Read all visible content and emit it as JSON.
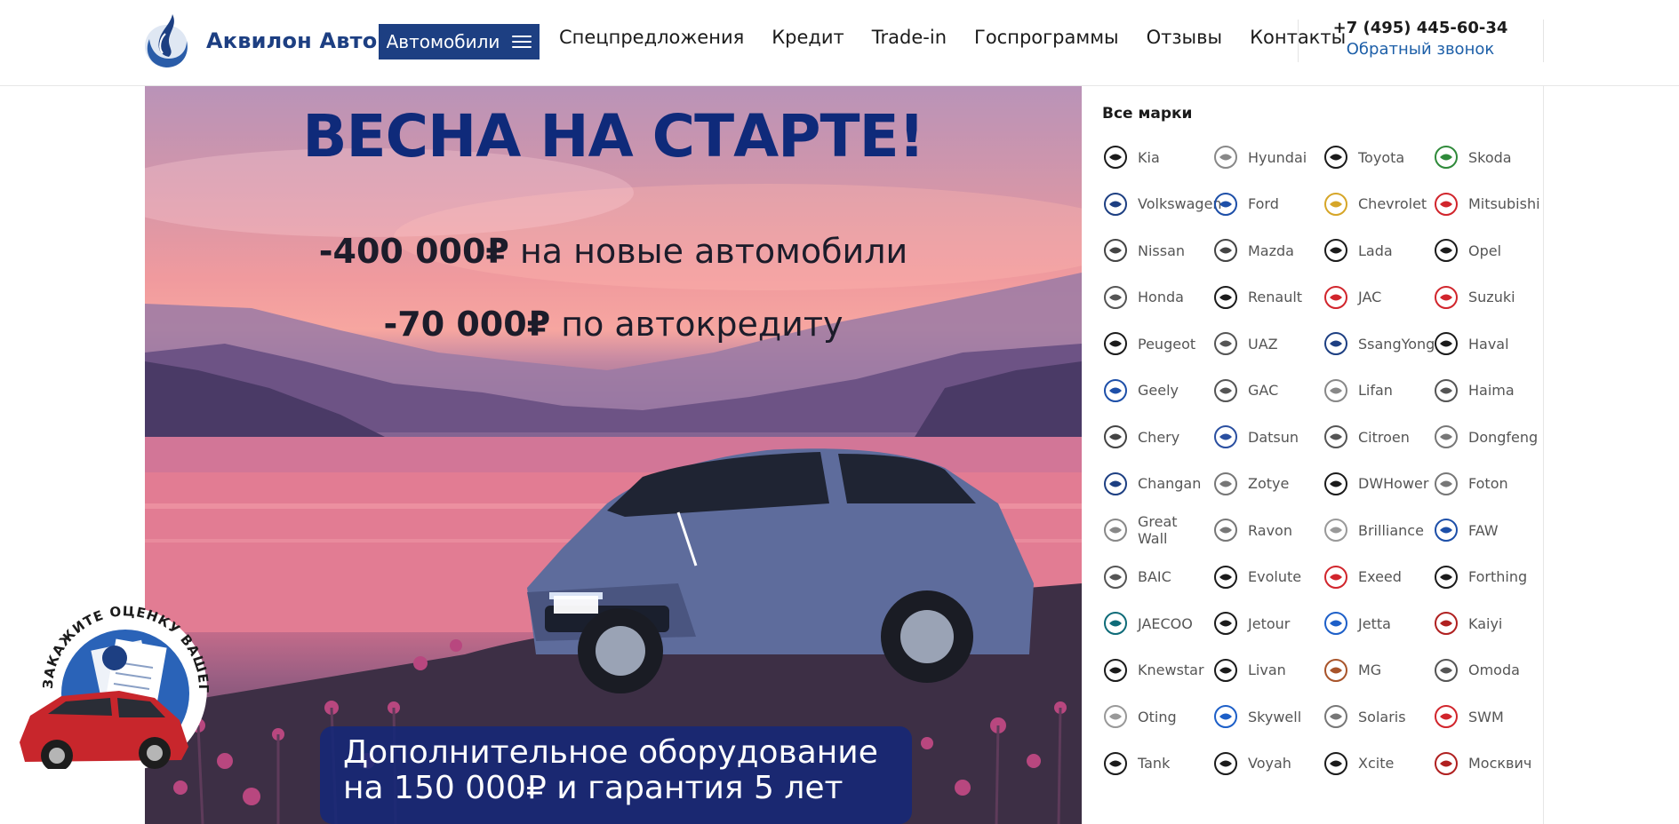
{
  "header": {
    "logo_text": "Аквилон Авто",
    "cars_button": "Автомобили",
    "nav": [
      "Спецпредложения",
      "Кредит",
      "Trade-in",
      "Госпрограммы",
      "Отзывы",
      "Контакты"
    ],
    "phone": "+7 (495) 445-60-34",
    "callback": "Обратный звонок"
  },
  "hero": {
    "title": "ВЕСНА НА СТАРТЕ!",
    "offer1_amount": "-400 000₽",
    "offer1_text": " на новые автомобили",
    "offer2_amount": "-70 000₽",
    "offer2_text": " по автокредиту",
    "banner_line1": "Дополнительное оборудование",
    "banner_line2": "на 150 000₽ и гарантия 5 лет",
    "sticker_text": "ЗАКАЖИТЕ ОЦЕНКУ ВАШЕГО АВТОМОБИЛЯ"
  },
  "brands": {
    "title": "Все марки",
    "items": [
      {
        "name": "Kia",
        "icon": "kia-logo"
      },
      {
        "name": "Hyundai",
        "icon": "hyundai-logo"
      },
      {
        "name": "Toyota",
        "icon": "toyota-logo"
      },
      {
        "name": "Skoda",
        "icon": "skoda-logo"
      },
      {
        "name": "Volkswagen",
        "icon": "volkswagen-logo"
      },
      {
        "name": "Ford",
        "icon": "ford-logo"
      },
      {
        "name": "Chevrolet",
        "icon": "chevrolet-logo"
      },
      {
        "name": "Mitsubishi",
        "icon": "mitsubishi-logo"
      },
      {
        "name": "Nissan",
        "icon": "nissan-logo"
      },
      {
        "name": "Mazda",
        "icon": "mazda-logo"
      },
      {
        "name": "Lada",
        "icon": "lada-logo"
      },
      {
        "name": "Opel",
        "icon": "opel-logo"
      },
      {
        "name": "Honda",
        "icon": "honda-logo"
      },
      {
        "name": "Renault",
        "icon": "renault-logo"
      },
      {
        "name": "JAC",
        "icon": "jac-logo"
      },
      {
        "name": "Suzuki",
        "icon": "suzuki-logo"
      },
      {
        "name": "Peugeot",
        "icon": "peugeot-logo"
      },
      {
        "name": "UAZ",
        "icon": "uaz-logo"
      },
      {
        "name": "SsangYong",
        "icon": "ssangyong-logo"
      },
      {
        "name": "Haval",
        "icon": "haval-logo"
      },
      {
        "name": "Geely",
        "icon": "geely-logo"
      },
      {
        "name": "GAC",
        "icon": "gac-logo"
      },
      {
        "name": "Lifan",
        "icon": "lifan-logo"
      },
      {
        "name": "Haima",
        "icon": "haima-logo"
      },
      {
        "name": "Chery",
        "icon": "chery-logo"
      },
      {
        "name": "Datsun",
        "icon": "datsun-logo"
      },
      {
        "name": "Citroen",
        "icon": "citroen-logo"
      },
      {
        "name": "Dongfeng",
        "icon": "dongfeng-logo"
      },
      {
        "name": "Changan",
        "icon": "changan-logo"
      },
      {
        "name": "Zotye",
        "icon": "zotye-logo"
      },
      {
        "name": "DWHower",
        "icon": "dwhower-logo"
      },
      {
        "name": "Foton",
        "icon": "foton-logo"
      },
      {
        "name": "Great Wall",
        "icon": "greatwall-logo"
      },
      {
        "name": "Ravon",
        "icon": "ravon-logo"
      },
      {
        "name": "Brilliance",
        "icon": "brilliance-logo"
      },
      {
        "name": "FAW",
        "icon": "faw-logo"
      },
      {
        "name": "BAIC",
        "icon": "baic-logo"
      },
      {
        "name": "Evolute",
        "icon": "evolute-logo"
      },
      {
        "name": "Exeed",
        "icon": "exeed-logo"
      },
      {
        "name": "Forthing",
        "icon": "forthing-logo"
      },
      {
        "name": "JAECOO",
        "icon": "jaecoo-logo"
      },
      {
        "name": "Jetour",
        "icon": "jetour-logo"
      },
      {
        "name": "Jetta",
        "icon": "jetta-logo"
      },
      {
        "name": "Kaiyi",
        "icon": "kaiyi-logo"
      },
      {
        "name": "Knewstar",
        "icon": "knewstar-logo"
      },
      {
        "name": "Livan",
        "icon": "livan-logo"
      },
      {
        "name": "MG",
        "icon": "mg-logo"
      },
      {
        "name": "Omoda",
        "icon": "omoda-logo"
      },
      {
        "name": "Oting",
        "icon": "oting-logo"
      },
      {
        "name": "Skywell",
        "icon": "skywell-logo"
      },
      {
        "name": "Solaris",
        "icon": "solaris-logo"
      },
      {
        "name": "SWM",
        "icon": "swm-logo"
      },
      {
        "name": "Tank",
        "icon": "tank-logo"
      },
      {
        "name": "Voyah",
        "icon": "voyah-logo"
      },
      {
        "name": "Xcite",
        "icon": "xcite-logo"
      },
      {
        "name": "Москвич",
        "icon": "moskvich-logo"
      }
    ]
  },
  "colors": {
    "brand_blue": "#1d3f82",
    "link_blue": "#1d5fa8",
    "title_navy": "#0f2a7a"
  }
}
